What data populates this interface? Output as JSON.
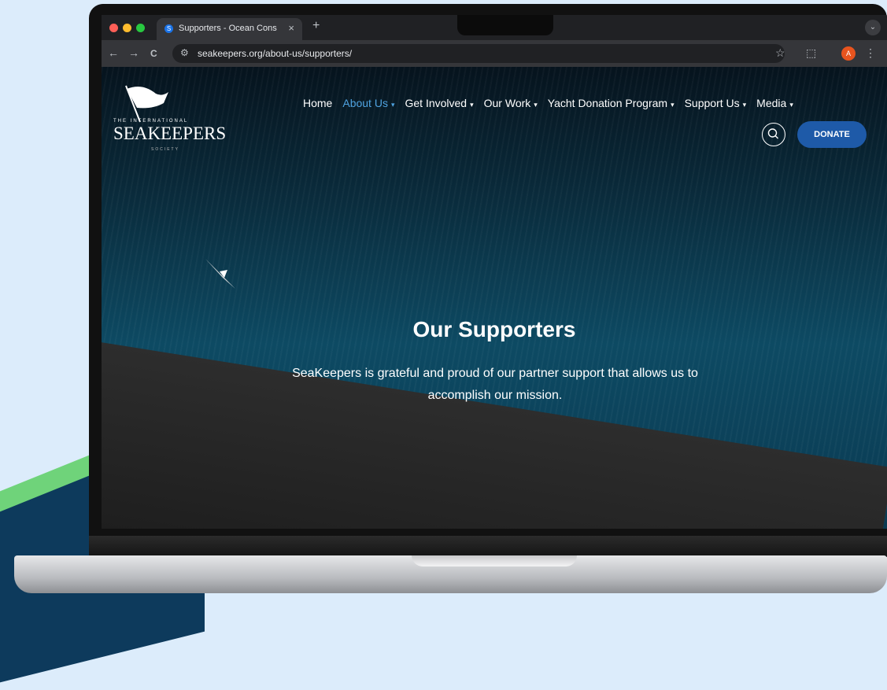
{
  "browser": {
    "tab_title": "Supporters - Ocean Conserv",
    "tab_close": "×",
    "new_tab": "+",
    "url": "seakeepers.org/about-us/supporters/",
    "profile_initial": "A",
    "icons": {
      "back": "←",
      "forward": "→",
      "reload": "C",
      "site_info": "⚙",
      "bookmark": "☆",
      "extensions": "⬚",
      "menu": "⋮",
      "tab_search": "⌄"
    }
  },
  "site": {
    "logo": {
      "the": "THE INTERNATIONAL",
      "main": "SEAKEEPERS",
      "society": "SOCIETY"
    },
    "nav": [
      {
        "label": "Home",
        "caret": ""
      },
      {
        "label": "About Us",
        "caret": "▾",
        "active": true
      },
      {
        "label": "Get Involved",
        "caret": "▾"
      },
      {
        "label": "Our Work",
        "caret": "▾"
      },
      {
        "label": "Yacht Donation Program",
        "caret": "▾"
      },
      {
        "label": "Support Us",
        "caret": "▾"
      },
      {
        "label": "Media",
        "caret": "▾"
      }
    ],
    "donate_label": "DONATE",
    "hero_title": "Our Supporters",
    "hero_subtitle": "SeaKeepers is grateful and proud of our partner support that allows us to accomplish our mission."
  },
  "colors": {
    "accent": "#1e5aa8",
    "active_nav": "#4fa3e0",
    "profile": "#e8541e"
  }
}
